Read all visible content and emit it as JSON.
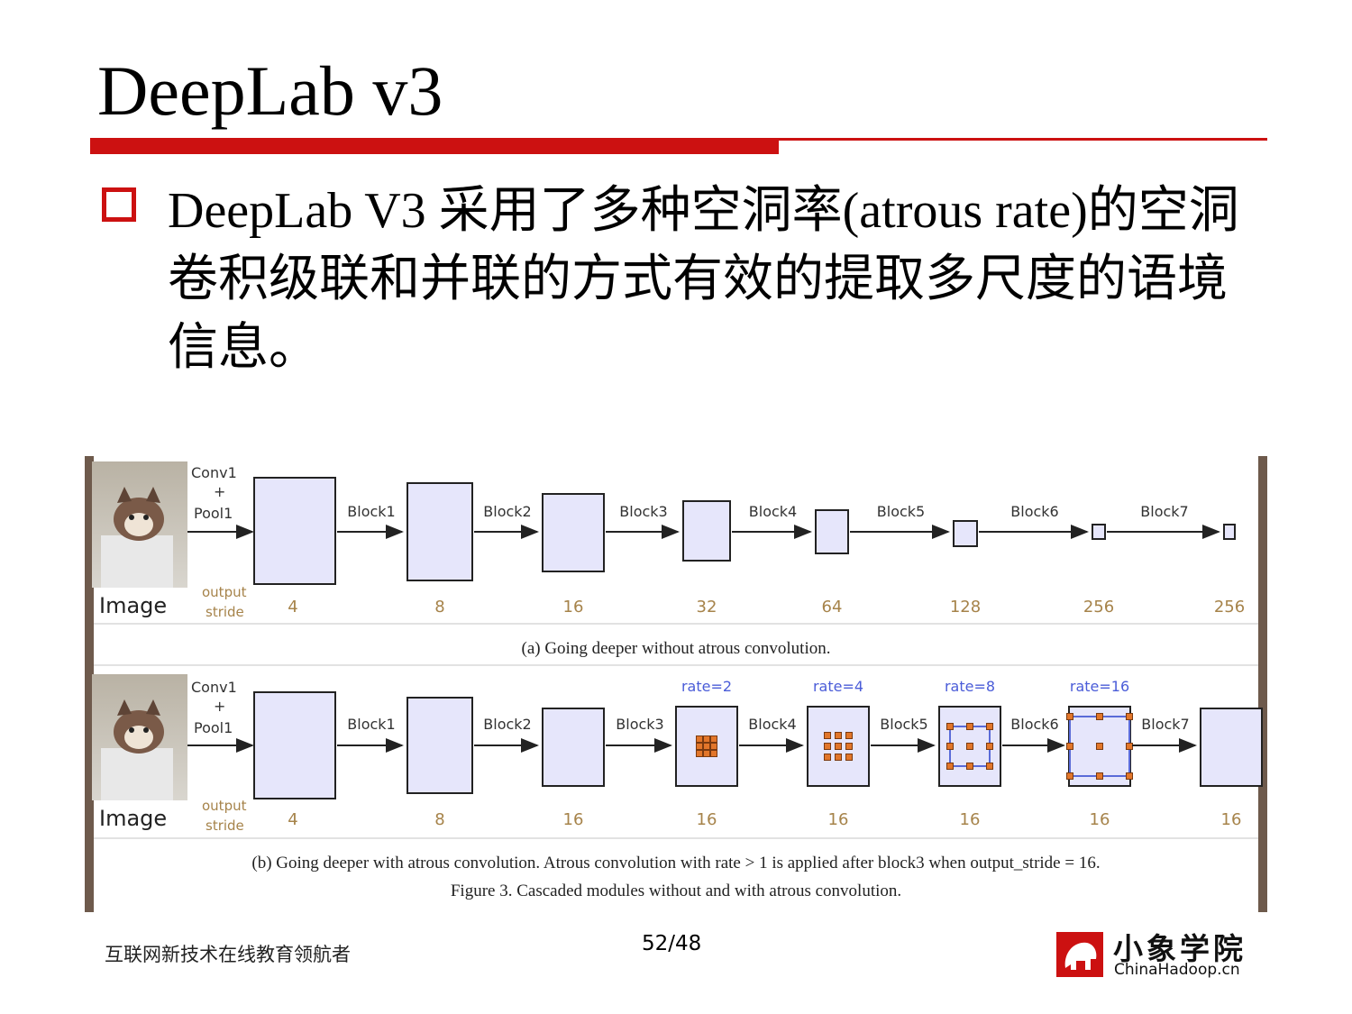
{
  "slide": {
    "title": "DeepLab v3",
    "bullet": "DeepLab V3 采用了多种空洞率(atrous rate)的空洞卷积级联和并联的方式有效的提取多尺度的语境信息。"
  },
  "figure": {
    "panel_a": {
      "stem_label_1": "Conv1",
      "stem_label_plus": "+",
      "stem_label_2": "Pool1",
      "image_label": "Image",
      "stride_label_1": "output",
      "stride_label_2": "stride",
      "blocks": [
        "Block1",
        "Block2",
        "Block3",
        "Block4",
        "Block5",
        "Block6",
        "Block7"
      ],
      "strides": [
        "4",
        "8",
        "16",
        "32",
        "64",
        "128",
        "256",
        "256"
      ],
      "caption": "(a) Going deeper without atrous convolution."
    },
    "panel_b": {
      "stem_label_1": "Conv1",
      "stem_label_plus": "+",
      "stem_label_2": "Pool1",
      "image_label": "Image",
      "stride_label_1": "output",
      "stride_label_2": "stride",
      "blocks": [
        "Block1",
        "Block2",
        "Block3",
        "Block4",
        "Block5",
        "Block6",
        "Block7"
      ],
      "rates": [
        "rate=2",
        "rate=4",
        "rate=8",
        "rate=16"
      ],
      "strides": [
        "4",
        "8",
        "16",
        "16",
        "16",
        "16",
        "16",
        "16"
      ],
      "caption": "(b) Going deeper with atrous convolution. Atrous convolution with rate > 1 is applied after block3 when output_stride = 16."
    },
    "figure_caption": "Figure 3. Cascaded modules without and with atrous convolution."
  },
  "footer": {
    "slogan": "互联网新技术在线教育领航者",
    "page": "52/48",
    "logo_cn": "小象学院",
    "logo_en": "ChinaHadoop.cn"
  },
  "colors": {
    "accent": "#cc1111",
    "box_fill": "#e6e6fb",
    "stride_text": "#a6834a",
    "rate_text": "#4a5cd8"
  }
}
